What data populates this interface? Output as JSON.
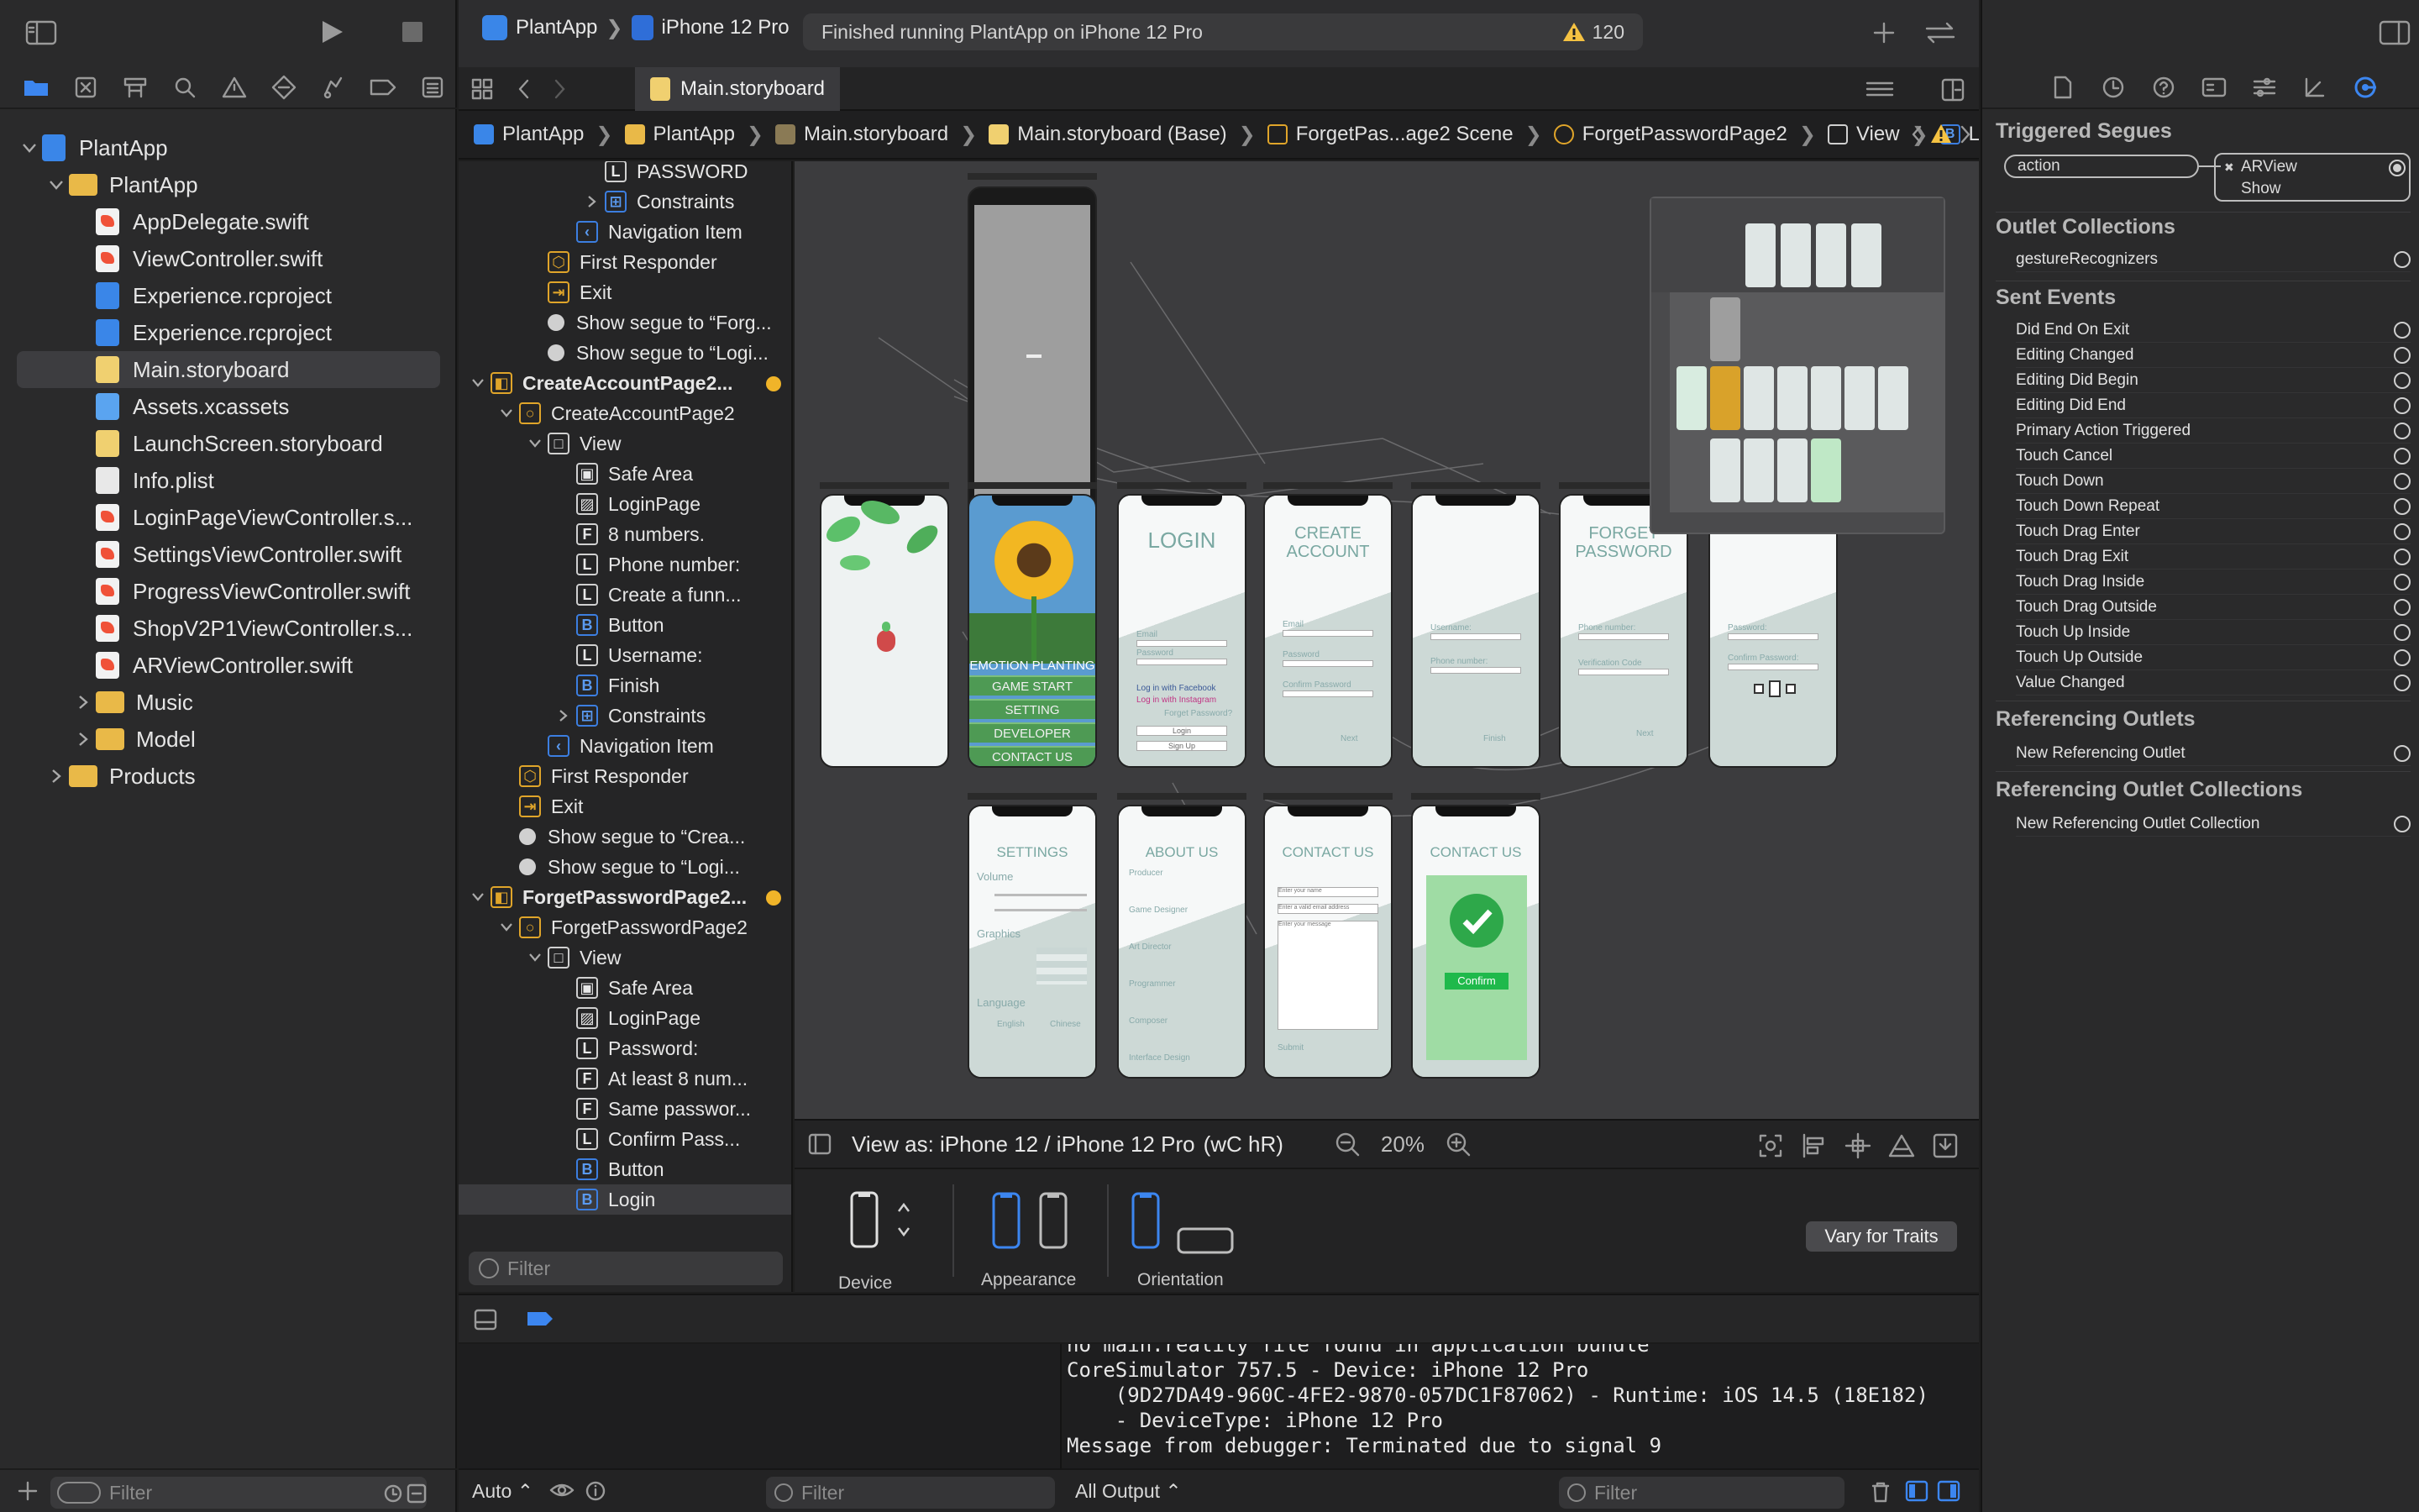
{
  "toolbar": {
    "scheme_project": "PlantApp",
    "scheme_device": "iPhone 12 Pro",
    "activity_status": "Finished running PlantApp on iPhone 12 Pro",
    "warning_count": "120"
  },
  "editor_tabs": [
    {
      "label": "Main.storyboard"
    }
  ],
  "jump_bar": [
    {
      "label": "PlantApp"
    },
    {
      "label": "PlantApp"
    },
    {
      "label": "Main.storyboard"
    },
    {
      "label": "Main.storyboard (Base)"
    },
    {
      "label": "ForgetPas...age2 Scene"
    },
    {
      "label": "ForgetPasswordPage2"
    },
    {
      "label": "View"
    },
    {
      "label": "Login"
    }
  ],
  "navigator": {
    "items": [
      {
        "label": "PlantApp",
        "kind": "project",
        "indent": 0,
        "open": true
      },
      {
        "label": "PlantApp",
        "kind": "folder",
        "indent": 1,
        "open": true
      },
      {
        "label": "AppDelegate.swift",
        "kind": "swift",
        "indent": 2
      },
      {
        "label": "ViewController.swift",
        "kind": "swift",
        "indent": 2
      },
      {
        "label": "Experience.rcproject",
        "kind": "rc",
        "indent": 2
      },
      {
        "label": "Experience.rcproject",
        "kind": "rc",
        "indent": 2
      },
      {
        "label": "Main.storyboard",
        "kind": "storyboard",
        "indent": 2,
        "selected": true
      },
      {
        "label": "Assets.xcassets",
        "kind": "assets",
        "indent": 2
      },
      {
        "label": "LaunchScreen.storyboard",
        "kind": "storyboard",
        "indent": 2
      },
      {
        "label": "Info.plist",
        "kind": "plist",
        "indent": 2
      },
      {
        "label": "LoginPageViewController.s...",
        "kind": "swift",
        "indent": 2
      },
      {
        "label": "SettingsViewController.swift",
        "kind": "swift",
        "indent": 2
      },
      {
        "label": "ProgressViewController.swift",
        "kind": "swift",
        "indent": 2
      },
      {
        "label": "ShopV2P1ViewController.s...",
        "kind": "swift",
        "indent": 2
      },
      {
        "label": "ARViewController.swift",
        "kind": "swift",
        "indent": 2
      },
      {
        "label": "Music",
        "kind": "folder",
        "indent": 2,
        "closed": true
      },
      {
        "label": "Model",
        "kind": "folder",
        "indent": 2,
        "closed": true
      },
      {
        "label": "Products",
        "kind": "folder",
        "indent": 1,
        "closed": true
      }
    ],
    "filter_placeholder": "Filter"
  },
  "outline": {
    "rows": [
      {
        "label": "PASSWORD",
        "icon": "L",
        "indent": 4
      },
      {
        "label": "Constraints",
        "icon": "constraints",
        "indent": 4,
        "closed": true
      },
      {
        "label": "Navigation Item",
        "icon": "<",
        "indent": 3
      },
      {
        "label": "First Responder",
        "icon": "responder",
        "indent": 2
      },
      {
        "label": "Exit",
        "icon": "exit",
        "indent": 2
      },
      {
        "label": "Show segue to “Forg...",
        "icon": "segue",
        "indent": 2
      },
      {
        "label": "Show segue to “Logi...",
        "icon": "segue",
        "indent": 2
      },
      {
        "label": "CreateAccountPage2...",
        "icon": "scene",
        "indent": 0,
        "bold": true,
        "open": true,
        "dot": true
      },
      {
        "label": "CreateAccountPage2",
        "icon": "vc",
        "indent": 1,
        "open": true
      },
      {
        "label": "View",
        "icon": "view",
        "indent": 2,
        "open": true
      },
      {
        "label": "Safe Area",
        "icon": "safe",
        "indent": 3
      },
      {
        "label": "LoginPage",
        "icon": "image",
        "indent": 3
      },
      {
        "label": "8 numbers.",
        "icon": "F",
        "indent": 3
      },
      {
        "label": "Phone number:",
        "icon": "L",
        "indent": 3
      },
      {
        "label": "Create a funn...",
        "icon": "L",
        "indent": 3
      },
      {
        "label": "Button",
        "icon": "B",
        "indent": 3
      },
      {
        "label": "Username:",
        "icon": "L",
        "indent": 3
      },
      {
        "label": "Finish",
        "icon": "B",
        "indent": 3
      },
      {
        "label": "Constraints",
        "icon": "constraints",
        "indent": 3,
        "closed": true
      },
      {
        "label": "Navigation Item",
        "icon": "<",
        "indent": 2
      },
      {
        "label": "First Responder",
        "icon": "responder",
        "indent": 1
      },
      {
        "label": "Exit",
        "icon": "exit",
        "indent": 1
      },
      {
        "label": "Show segue to “Crea...",
        "icon": "segue",
        "indent": 1
      },
      {
        "label": "Show segue to “Logi...",
        "icon": "segue",
        "indent": 1
      },
      {
        "label": "ForgetPasswordPage2...",
        "icon": "scene",
        "indent": 0,
        "bold": true,
        "open": true,
        "dot": true
      },
      {
        "label": "ForgetPasswordPage2",
        "icon": "vc",
        "indent": 1,
        "open": true
      },
      {
        "label": "View",
        "icon": "view",
        "indent": 2,
        "open": true
      },
      {
        "label": "Safe Area",
        "icon": "safe",
        "indent": 3
      },
      {
        "label": "LoginPage",
        "icon": "image",
        "indent": 3
      },
      {
        "label": "Password:",
        "icon": "L",
        "indent": 3
      },
      {
        "label": "At least 8 num...",
        "icon": "F",
        "indent": 3
      },
      {
        "label": "Same passwor...",
        "icon": "F",
        "indent": 3
      },
      {
        "label": "Confirm Pass...",
        "icon": "L",
        "indent": 3
      },
      {
        "label": "Button",
        "icon": "B",
        "indent": 3
      },
      {
        "label": "Login",
        "icon": "B",
        "indent": 3,
        "selected": true
      }
    ],
    "filter_placeholder": "Filter"
  },
  "canvas": {
    "screens": {
      "emotion": {
        "title": "EMOTION PLANTING",
        "buttons": [
          "GAME START",
          "SETTING",
          "DEVELOPER",
          "CONTACT US"
        ]
      },
      "login": {
        "title": "LOGIN",
        "fields": [
          "Email",
          "Password"
        ],
        "social": [
          "Log in with Facebook",
          "Log in with Instagram"
        ],
        "link": "Forget Password?",
        "buttons": [
          "Login",
          "Sign Up"
        ]
      },
      "create": {
        "title": "CREATE ACCOUNT",
        "fields": [
          "Email",
          "Password",
          "Confirm Password"
        ],
        "button": "Next"
      },
      "create2": {
        "fields": [
          "Username:",
          "Phone number:"
        ],
        "button": "Finish"
      },
      "forget": {
        "title": "FORGET PASSWORD",
        "fields": [
          "Phone number:",
          "Verification Code"
        ],
        "button": "Next"
      },
      "forget2": {
        "fields": [
          "Password:",
          "Confirm Password:"
        ]
      },
      "settings": {
        "title": "SETTINGS",
        "sections": [
          "Volume",
          "Graphics",
          "Language"
        ],
        "langs": [
          "English",
          "Chinese"
        ]
      },
      "about": {
        "title": "ABOUT US",
        "sections": [
          "Producer",
          "Game Designer",
          "Art Director",
          "Programmer",
          "Composer",
          "Interface Design"
        ]
      },
      "contact": {
        "title": "CONTACT US",
        "fields": [
          "Enter your name",
          "Enter a valid email address",
          "Enter your message"
        ],
        "button": "Submit"
      },
      "contact2": {
        "title": "CONTACT US",
        "button": "Confirm"
      }
    }
  },
  "view_as": {
    "label": "View as: iPhone 12 / iPhone 12 Pro",
    "traits": "(wC hR)",
    "zoom": "20%"
  },
  "device_config": {
    "device_label": "Device",
    "appearance_label": "Appearance",
    "orientation_label": "Orientation",
    "vary_button": "Vary for Traits"
  },
  "console": {
    "lines": [
      "no main.reality file found in application bundle",
      "CoreSimulator 757.5 - Device: iPhone 12 Pro",
      "    (9D27DA49-960C-4FE2-9870-057DC1F87062) - Runtime: iOS 14.5 (18E182)",
      "    - DeviceType: iPhone 12 Pro",
      "Message from debugger: Terminated due to signal 9"
    ],
    "output_select": "All Output",
    "vars_select": "Auto",
    "filter_placeholder": "Filter"
  },
  "inspector": {
    "triggered_segues": {
      "title": "Triggered Segues",
      "source": "action",
      "target": "ARView",
      "target_kind": "Show"
    },
    "outlet_collections": {
      "title": "Outlet Collections",
      "items": [
        "gestureRecognizers"
      ]
    },
    "sent_events": {
      "title": "Sent Events",
      "items": [
        "Did End On Exit",
        "Editing Changed",
        "Editing Did Begin",
        "Editing Did End",
        "Primary Action Triggered",
        "Touch Cancel",
        "Touch Down",
        "Touch Down Repeat",
        "Touch Drag Enter",
        "Touch Drag Exit",
        "Touch Drag Inside",
        "Touch Drag Outside",
        "Touch Up Inside",
        "Touch Up Outside",
        "Value Changed"
      ]
    },
    "referencing_outlets": {
      "title": "Referencing Outlets",
      "items": [
        "New Referencing Outlet"
      ]
    },
    "referencing_outlet_collections": {
      "title": "Referencing Outlet Collections",
      "items": [
        "New Referencing Outlet Collection"
      ]
    }
  },
  "colors": {
    "accent": "#3c7ee0",
    "warning": "#f5c242",
    "scene_dot": "#f0b429",
    "canvas_bg": "#3c3c3e"
  }
}
